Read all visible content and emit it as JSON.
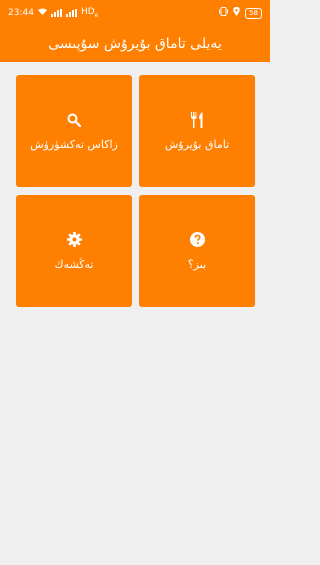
{
  "status_bar": {
    "time": "23:44",
    "network_label": "HD",
    "network_sub": "e",
    "battery": "58"
  },
  "app_bar": {
    "title": "يەيلى تاماق بۇيرۇش سۇپىسى"
  },
  "menu": {
    "tiles": [
      {
        "label": "تاماق بۇيرۇش",
        "icon": "fork-knife-icon"
      },
      {
        "label": "زاكاس تەكشۈرۈش",
        "icon": "search-icon"
      },
      {
        "label": "بىز؟",
        "icon": "question-circle-icon"
      },
      {
        "label": "تەڭشەك",
        "icon": "gear-icon"
      }
    ]
  },
  "colors": {
    "accent": "#ff7f00",
    "background": "#efefef",
    "text_on_accent": "#ffffff"
  }
}
